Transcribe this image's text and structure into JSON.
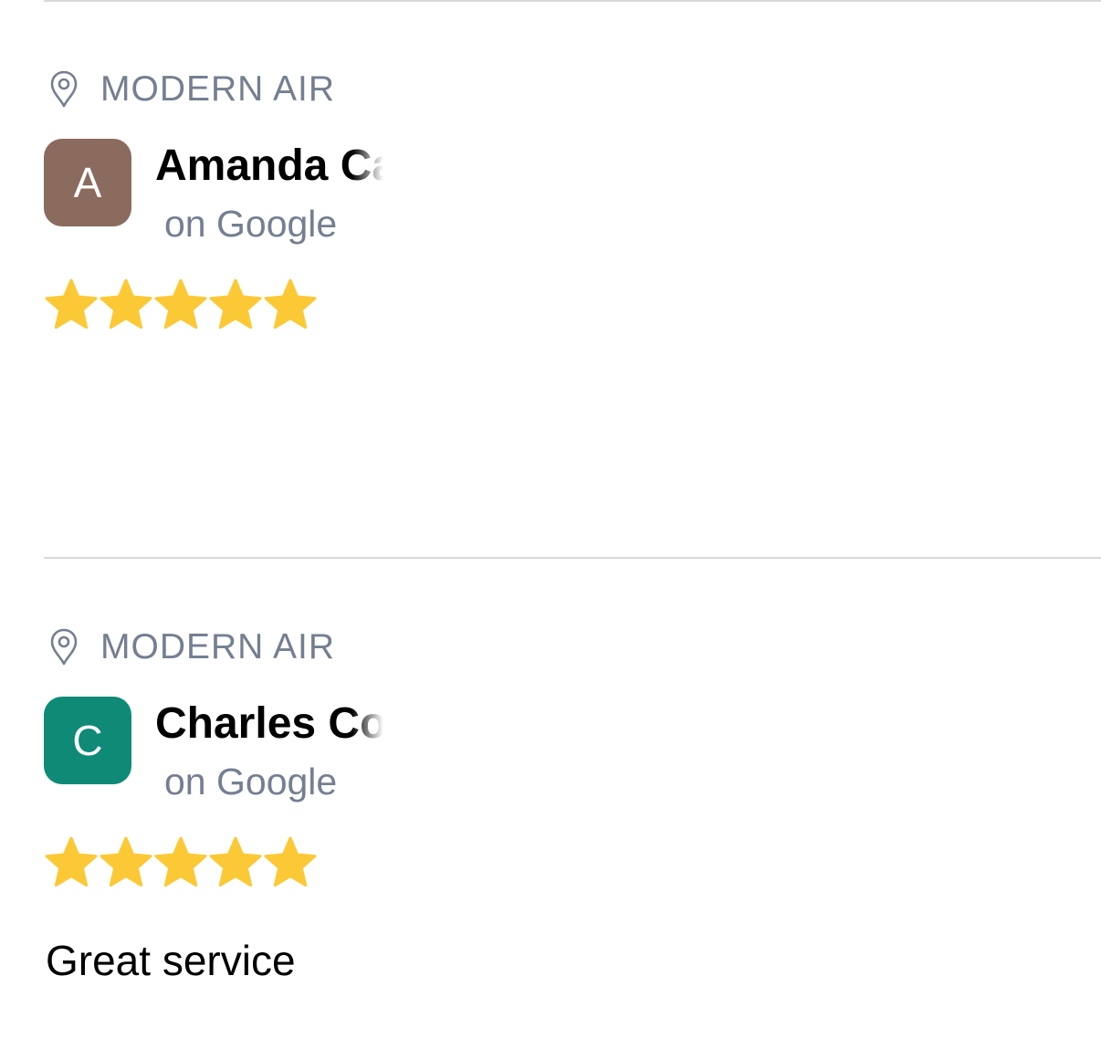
{
  "reviews": [
    {
      "location": "MODERN AIR",
      "initial": "A",
      "avatar_color": "#8b6b5e",
      "name": "Amanda Ca",
      "platform": "on Google",
      "rating": 5,
      "text": ""
    },
    {
      "location": "MODERN AIR",
      "initial": "C",
      "avatar_color": "#0e8a77",
      "name": "Charles Co",
      "platform": "on Google",
      "rating": 5,
      "text": "Great service"
    }
  ],
  "colors": {
    "star": "#fcc936",
    "muted_text": "#747f91",
    "divider": "#d9d9dd"
  },
  "icons": {
    "location": "map-pin-icon",
    "rating": "star-icon"
  }
}
